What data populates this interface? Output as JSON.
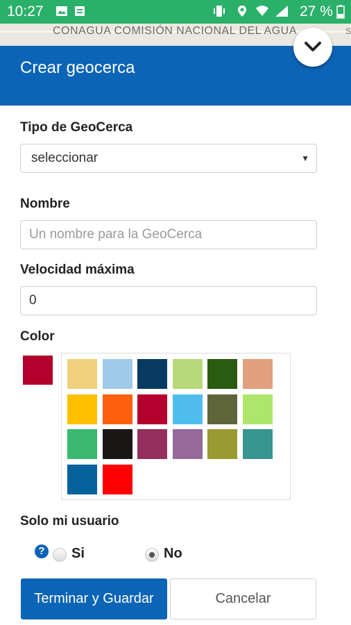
{
  "status_bar": {
    "time": "10:27",
    "battery": "27 %"
  },
  "map": {
    "label": "CONAGUA COMISIÓN NACIONAL DEL AGUA",
    "edge_letter": "S"
  },
  "header": {
    "title": "Crear geocerca"
  },
  "form": {
    "tipo_label": "Tipo de GeoCerca",
    "tipo_value": "seleccionar",
    "nombre_label": "Nombre",
    "nombre_placeholder": "Un nombre para la GeoCerca",
    "velocidad_label": "Velocidad máxima",
    "velocidad_value": "0",
    "color_label": "Color",
    "selected_color": "#b4002c",
    "palette": [
      "#efd17d",
      "#9fcbe9",
      "#073b63",
      "#b6d97a",
      "#2b5a11",
      "#e1a07e",
      "#ffc000",
      "#fe5f0c",
      "#b4002c",
      "#4fbeee",
      "#5e653b",
      "#ade66a",
      "#3ab86f",
      "#1b1616",
      "#942f5d",
      "#956a9a",
      "#999a32",
      "#38958f",
      "#06629d",
      "#ff0000"
    ],
    "solo_label": "Solo mi usuario",
    "option_si": "Si",
    "option_no": "No",
    "selected_option": "No"
  },
  "buttons": {
    "save": "Terminar y Guardar",
    "cancel": "Cancelar"
  }
}
